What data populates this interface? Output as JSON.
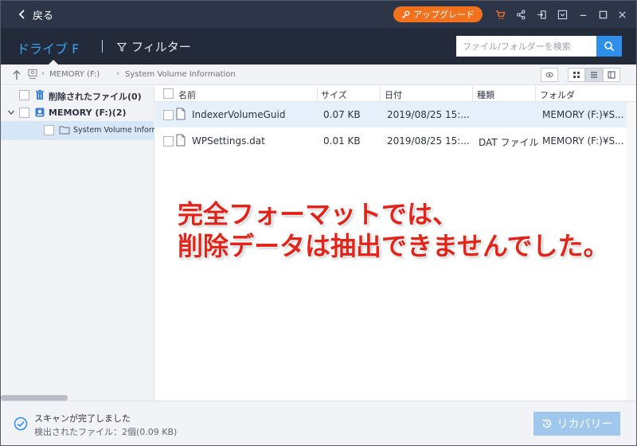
{
  "titlebar": {
    "back_label": "戻る",
    "upgrade_label": "アップグレード",
    "icons": [
      "cart-icon",
      "share-icon",
      "signin-icon",
      "menu-icon",
      "minimize-icon",
      "maximize-icon",
      "close-icon"
    ]
  },
  "header": {
    "drive_tab": "ドライブ F",
    "filter_label": "フィルター",
    "search_placeholder": "ファイル/フォルダーを検索"
  },
  "breadcrumb": {
    "items": [
      "MEMORY (F:)",
      "System Volume Information"
    ]
  },
  "tree": {
    "deleted_label": "削除されたファイル(0)",
    "drive_label": "MEMORY (F:)(2)",
    "folder_label": "System Volume Informat"
  },
  "list": {
    "columns": [
      "名前",
      "サイズ",
      "日付",
      "種類",
      "フォルダ"
    ],
    "rows": [
      {
        "name": "IndexerVolumeGuid",
        "size": "0.07 KB",
        "date": "2019/08/25 15:...",
        "type": "",
        "folder": "MEMORY (F:)¥S..."
      },
      {
        "name": "WPSettings.dat",
        "size": "0.01 KB",
        "date": "2019/08/25 15:...",
        "type": "DAT ファイル",
        "folder": "MEMORY (F:)¥S..."
      }
    ]
  },
  "annotation": {
    "line1": "完全フォーマットでは、",
    "line2": "削除データは抽出できませんでした。",
    "color": "#e1251b"
  },
  "footer": {
    "status_main": "スキャンが完了しました",
    "status_sub": "検出されたファイル：2個(0.09 KB)",
    "recover_label": "リカバリー"
  },
  "colors": {
    "titlebar": "#2d3648",
    "header": "#232b3b",
    "accent": "#3aa0f0",
    "upgrade": "#f2711c",
    "recover_disabled": "#9fc8ec"
  }
}
